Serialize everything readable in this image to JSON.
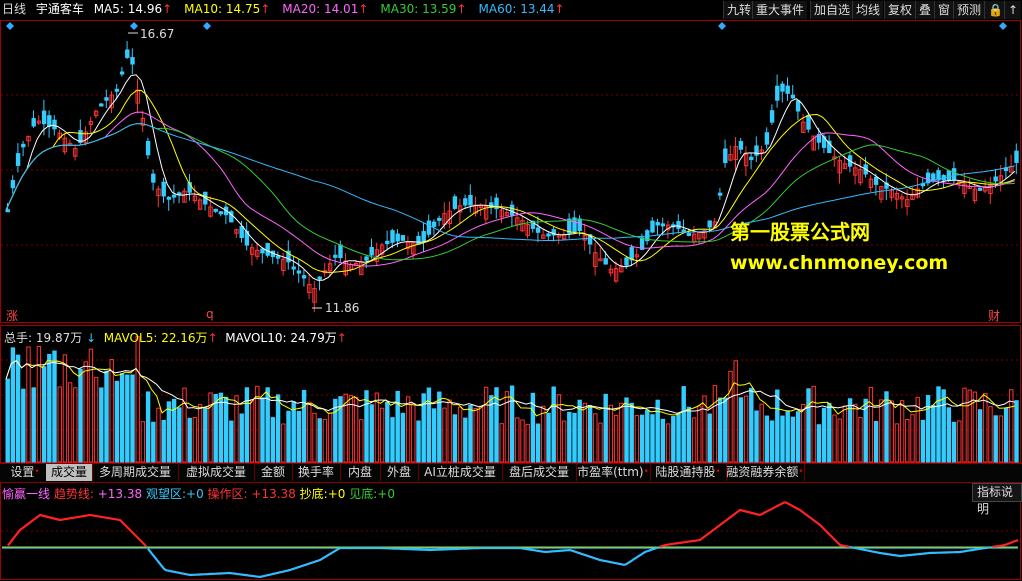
{
  "header": {
    "period": "日线",
    "stock_name": "宇通客车",
    "ma": [
      {
        "label": "MA5:",
        "value": "14.96",
        "arrow": "↑",
        "color": "#ffffff"
      },
      {
        "label": "MA10:",
        "value": "14.75",
        "arrow": "↑",
        "color": "#ffff00"
      },
      {
        "label": "MA20:",
        "value": "14.01",
        "arrow": "↑",
        "color": "#ff66ff"
      },
      {
        "label": "MA30:",
        "value": "13.59",
        "arrow": "↑",
        "color": "#33cc33"
      },
      {
        "label": "MA60:",
        "value": "13.44",
        "arrow": "↑",
        "color": "#33bbff"
      }
    ],
    "buttons": [
      "九转",
      "重大事件",
      "加自选",
      "均线",
      "复权",
      "叠",
      "窗",
      "预测"
    ]
  },
  "price_chart": {
    "high_label": "16.67",
    "low_label": "11.86",
    "marker_left": "涨",
    "marker_mid": "q",
    "marker_right": "财",
    "watermark_line1": "第一股票公式网",
    "watermark_line2": "www.chnmoney.com"
  },
  "volume": {
    "label": "总手:",
    "value": "19.87万",
    "arrow": "↓",
    "mavol5_label": "MAVOL5:",
    "mavol5_value": "22.16万",
    "mavol10_label": "MAVOL10:",
    "mavol10_value": "24.79万"
  },
  "tabs": [
    "设置",
    "成交量",
    "多周期成交量",
    "虚拟成交量",
    "金额",
    "换手率",
    "内盘",
    "外盘",
    "AI立桩成交量",
    "盘后成交量",
    "市盈率(ttm)",
    "陆股通持股",
    "融资融券余额"
  ],
  "indicator": {
    "name": "愉赢一线",
    "trend_label": "趋势线:",
    "trend_value": "+13.38",
    "watch_label": "观望区:",
    "watch_value": "+0",
    "op_label": "操作区:",
    "op_value": "+13.38",
    "bottom_label": "抄底:",
    "bottom_value": "+0",
    "see_label": "见底:",
    "see_value": "+0",
    "help_button": "指标说明"
  },
  "colors": {
    "up": "#ff3333",
    "down": "#33ccff",
    "ma5": "#ffffff",
    "ma10": "#ffff00",
    "ma20": "#ff66ff",
    "ma30": "#33cc33",
    "ma60": "#33bbff",
    "grid": "#7a0000",
    "watermark": "#ffff00"
  }
}
